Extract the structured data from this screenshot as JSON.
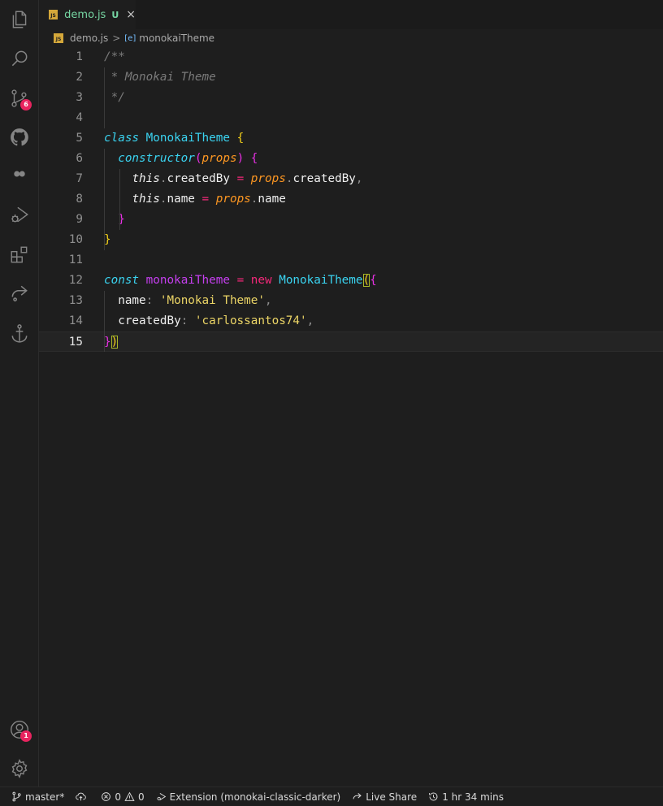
{
  "activity_bar": {
    "source_control_badge": "6",
    "accounts_badge": "1",
    "icons": [
      "explorer-icon",
      "search-icon",
      "source-control-icon",
      "github-icon",
      "toggle-icon",
      "run-debug-icon",
      "extensions-icon",
      "live-share-icon",
      "anchor-icon",
      "accounts-icon",
      "settings-gear-icon"
    ]
  },
  "tab": {
    "file_icon": "JS",
    "label": "demo.js",
    "status": "U",
    "close": "×"
  },
  "breadcrumb": {
    "file_icon": "JS",
    "file": "demo.js",
    "separator": ">",
    "symbol_icon": "[e]",
    "symbol": "monokaiTheme"
  },
  "editor": {
    "current_line": 15,
    "lines": [
      {
        "n": "1",
        "tokens": [
          {
            "t": "/**",
            "c": "cm"
          }
        ]
      },
      {
        "n": "2",
        "tokens": [
          {
            "t": " * Monokai Theme",
            "c": "cm"
          }
        ]
      },
      {
        "n": "3",
        "tokens": [
          {
            "t": " */",
            "c": "cm"
          }
        ]
      },
      {
        "n": "4",
        "tokens": []
      },
      {
        "n": "5",
        "tokens": [
          {
            "t": "class",
            "c": "kw"
          },
          {
            "t": " "
          },
          {
            "t": "MonokaiTheme",
            "c": "cls"
          },
          {
            "t": " "
          },
          {
            "t": "{",
            "c": "b1"
          }
        ]
      },
      {
        "n": "6",
        "tokens": [
          {
            "t": "  "
          },
          {
            "t": "constructor",
            "c": "fn"
          },
          {
            "t": "(",
            "c": "b2"
          },
          {
            "t": "props",
            "c": "prm"
          },
          {
            "t": ")",
            "c": "b2"
          },
          {
            "t": " "
          },
          {
            "t": "{",
            "c": "b2"
          }
        ]
      },
      {
        "n": "7",
        "tokens": [
          {
            "t": "    "
          },
          {
            "t": "this",
            "c": "this"
          },
          {
            "t": ".",
            "c": "p"
          },
          {
            "t": "createdBy"
          },
          {
            "t": " "
          },
          {
            "t": "=",
            "c": "op"
          },
          {
            "t": " "
          },
          {
            "t": "props",
            "c": "prm"
          },
          {
            "t": ".",
            "c": "p"
          },
          {
            "t": "createdBy"
          },
          {
            "t": ",",
            "c": "p"
          }
        ]
      },
      {
        "n": "8",
        "tokens": [
          {
            "t": "    "
          },
          {
            "t": "this",
            "c": "this"
          },
          {
            "t": ".",
            "c": "p"
          },
          {
            "t": "name"
          },
          {
            "t": " "
          },
          {
            "t": "=",
            "c": "op"
          },
          {
            "t": " "
          },
          {
            "t": "props",
            "c": "prm"
          },
          {
            "t": ".",
            "c": "p"
          },
          {
            "t": "name"
          }
        ]
      },
      {
        "n": "9",
        "tokens": [
          {
            "t": "  "
          },
          {
            "t": "}",
            "c": "b2"
          }
        ]
      },
      {
        "n": "10",
        "tokens": [
          {
            "t": "}",
            "c": "b1"
          }
        ]
      },
      {
        "n": "11",
        "tokens": []
      },
      {
        "n": "12",
        "tokens": [
          {
            "t": "const",
            "c": "kw"
          },
          {
            "t": " "
          },
          {
            "t": "monokaiTheme",
            "c": "var"
          },
          {
            "t": " "
          },
          {
            "t": "=",
            "c": "op"
          },
          {
            "t": " "
          },
          {
            "t": "new",
            "c": "new"
          },
          {
            "t": " "
          },
          {
            "t": "MonokaiTheme",
            "c": "cls"
          },
          {
            "t": "(",
            "c": "b1 bm"
          },
          {
            "t": "{",
            "c": "b2"
          }
        ]
      },
      {
        "n": "13",
        "tokens": [
          {
            "t": "  "
          },
          {
            "t": "name"
          },
          {
            "t": ":",
            "c": "p"
          },
          {
            "t": " "
          },
          {
            "t": "'Monokai Theme'",
            "c": "str"
          },
          {
            "t": ",",
            "c": "p"
          }
        ]
      },
      {
        "n": "14",
        "tokens": [
          {
            "t": "  "
          },
          {
            "t": "createdBy"
          },
          {
            "t": ":",
            "c": "p"
          },
          {
            "t": " "
          },
          {
            "t": "'carlossantos74'",
            "c": "str"
          },
          {
            "t": ",",
            "c": "p"
          }
        ]
      },
      {
        "n": "15",
        "tokens": [
          {
            "t": "}",
            "c": "b2"
          },
          {
            "t": ")",
            "c": "b1 bm"
          }
        ]
      }
    ]
  },
  "status_bar": {
    "branch": "master*",
    "errors": "0",
    "warnings": "0",
    "extension": "Extension (monokai-classic-darker)",
    "live_share": "Live Share",
    "timer": "1 hr 34 mins"
  },
  "colors": {
    "background": "#1e1e1e",
    "badge": "#e8245f",
    "tab_label": "#76d6a3"
  }
}
